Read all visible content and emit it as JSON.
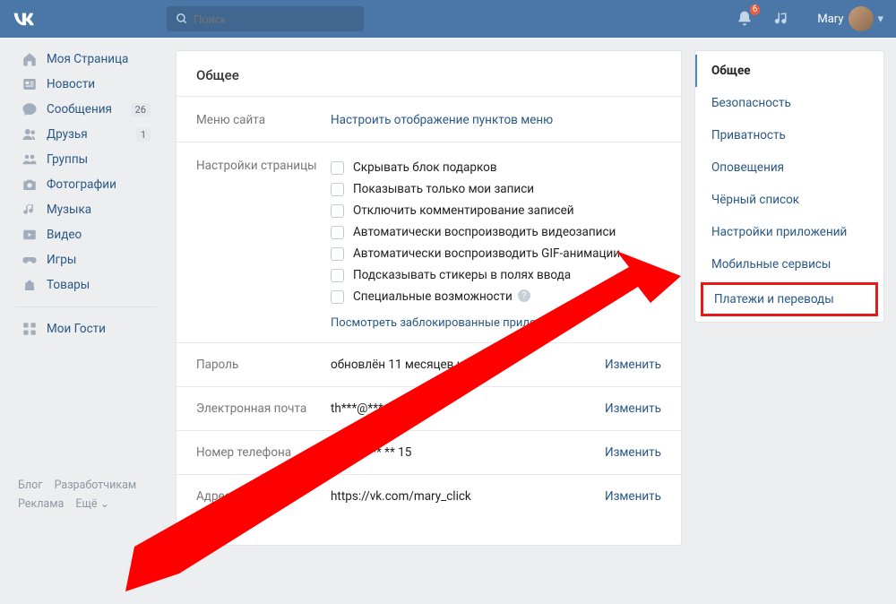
{
  "header": {
    "search_placeholder": "Поиск",
    "notif_count": "6",
    "username": "Mary"
  },
  "leftnav": {
    "items": [
      {
        "icon": "home",
        "label": "Моя Страница"
      },
      {
        "icon": "news",
        "label": "Новости"
      },
      {
        "icon": "msg",
        "label": "Сообщения",
        "count": "26"
      },
      {
        "icon": "friends",
        "label": "Друзья",
        "count": "1"
      },
      {
        "icon": "groups",
        "label": "Группы"
      },
      {
        "icon": "photo",
        "label": "Фотографии"
      },
      {
        "icon": "music",
        "label": "Музыка"
      },
      {
        "icon": "video",
        "label": "Видео"
      },
      {
        "icon": "games",
        "label": "Игры"
      },
      {
        "icon": "goods",
        "label": "Товары"
      }
    ],
    "guests_label": "Мои Гости",
    "footer": [
      "Блог",
      "Разработчикам",
      "Реклама",
      "Ещё ⌄"
    ]
  },
  "settings": {
    "title": "Общее",
    "menu_label": "Меню сайта",
    "menu_link": "Настроить отображение пунктов меню",
    "page_label": "Настройки страницы",
    "checks": [
      "Скрывать блок подарков",
      "Показывать только мои записи",
      "Отключить комментирование записей",
      "Автоматически воспроизводить видеозаписи",
      "Автоматически воспроизводить GIF-анимации",
      "Подсказывать стикеры в полях ввода",
      "Специальные возможности"
    ],
    "blocked_link": "Посмотреть заблокированные приложения",
    "rows": {
      "password_label": "Пароль",
      "password_val": "обновлён 11 месяцев назад",
      "email_label": "Электронная почта",
      "email_val": "th***@***.com",
      "phone_label": "Номер телефона",
      "phone_val": "+7 *** *** ** 15",
      "url_label": "Адрес страницы",
      "url_val": "https://vk.com/mary_click",
      "change": "Изменить"
    }
  },
  "sidetabs": [
    "Общее",
    "Безопасность",
    "Приватность",
    "Оповещения",
    "Чёрный список",
    "Настройки приложений",
    "Мобильные сервисы",
    "Платежи и переводы"
  ]
}
